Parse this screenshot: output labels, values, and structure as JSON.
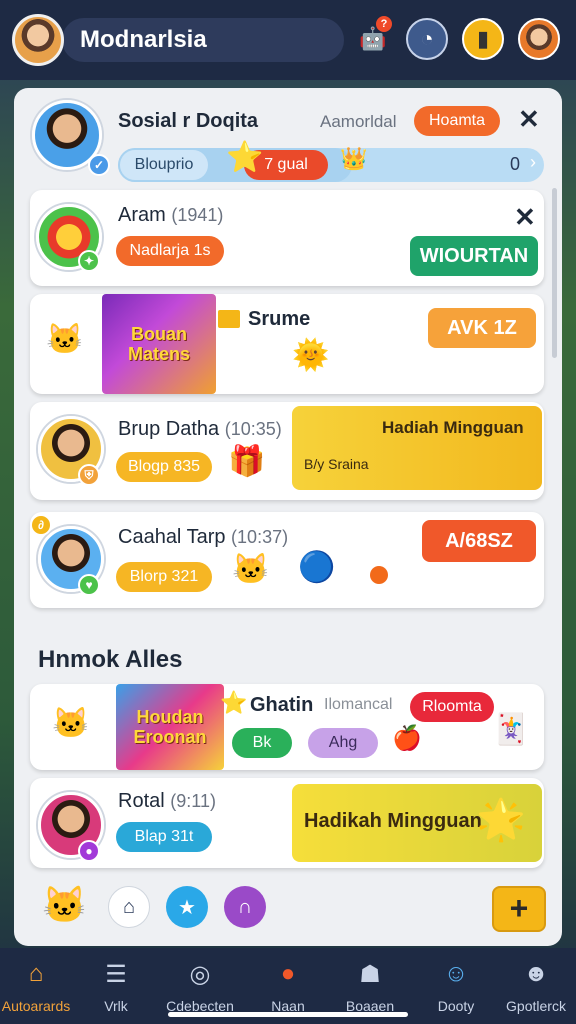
{
  "header": {
    "title": "Modnarlsia",
    "notification_count": "?"
  },
  "panel": {
    "top_card": {
      "name": "Sosial r Doqita",
      "status_text": "Aamorldal",
      "action_label": "Hoamta",
      "tag": "Blouprio",
      "progress_label": "7 gual",
      "progress_value": "0",
      "progress_fraction": 0.55,
      "accent_color": "#f2a23a"
    },
    "rows": [
      {
        "name": "Aram",
        "time": "(1941)",
        "pill": "Nadlarja 1s",
        "button": "WIOURTAN"
      },
      {
        "game_title": "Bouan Matens",
        "label": "Srume",
        "button": "AVK 1Z"
      },
      {
        "name": "Brup Datha",
        "time": "(10:35)",
        "pill": "Blogp 835",
        "banner_title": "Hadiah Mingguan",
        "banner_sub": "B/y Sraina"
      },
      {
        "name": "Caahal Tarp",
        "time": "(10:37)",
        "pill": "Blorp 321",
        "button": "A/68SZ"
      }
    ],
    "section_title": "Hnmok Alles",
    "section_rows": [
      {
        "game_title": "Houdan Eroonan",
        "label": "Ghatin",
        "status_text": "Ilomancal",
        "action_label": "Rloomta",
        "chip1": "Bk",
        "chip2": "Ahg"
      },
      {
        "name": "Rotal",
        "time": "(9:11)",
        "pill": "Blap 31t",
        "banner_title": "Hadikah Mingguan"
      }
    ]
  },
  "bottom_nav": [
    {
      "label": "Autoarards",
      "icon": "home-icon",
      "active": true
    },
    {
      "label": "Vrlk",
      "icon": "list-icon",
      "active": false
    },
    {
      "label": "Cdebecten",
      "icon": "compass-icon",
      "active": false
    },
    {
      "label": "Naan",
      "icon": "game-icon",
      "active": false
    },
    {
      "label": "Boaaen",
      "icon": "robot-icon",
      "active": false
    },
    {
      "label": "Dooty",
      "icon": "people-icon",
      "active": false
    },
    {
      "label": "Gpotlerck",
      "icon": "profile-icon",
      "active": false
    }
  ]
}
